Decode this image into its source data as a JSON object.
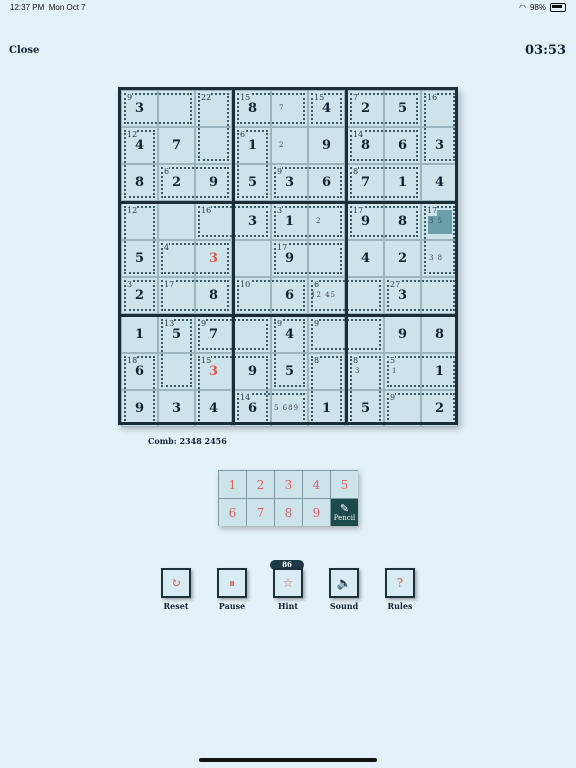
{
  "status": {
    "time": "12:37 PM",
    "date": "Mon Oct 7",
    "battery": "98%"
  },
  "header": {
    "close_label": "Close",
    "timer": "03:53"
  },
  "grid": {
    "values": [
      [
        "3",
        "",
        "",
        "8",
        "",
        "4",
        "2",
        "5",
        ""
      ],
      [
        "4",
        "7",
        "",
        "1",
        "",
        "9",
        "8",
        "6",
        "3"
      ],
      [
        "8",
        "2",
        "9",
        "5",
        "3",
        "6",
        "7",
        "1",
        "4"
      ],
      [
        "",
        "",
        "",
        "3",
        "1",
        "",
        "9",
        "8",
        ""
      ],
      [
        "5",
        "",
        "3",
        "",
        "9",
        "",
        "4",
        "2",
        ""
      ],
      [
        "2",
        "",
        "8",
        "",
        "6",
        "",
        "",
        "3",
        ""
      ],
      [
        "1",
        "5",
        "7",
        "",
        "4",
        "",
        "",
        "9",
        "8"
      ],
      [
        "6",
        "",
        "3",
        "9",
        "5",
        "",
        "",
        "",
        "1"
      ],
      [
        "9",
        "3",
        "4",
        "6",
        "",
        "1",
        "5",
        "",
        "2"
      ]
    ],
    "user_cells": [
      [
        4,
        2
      ],
      [
        7,
        2
      ]
    ],
    "selected": [
      3,
      8
    ],
    "pencil": [
      {
        "r": 0,
        "c": 4,
        "text": "7"
      },
      {
        "r": 1,
        "c": 4,
        "text": "2"
      },
      {
        "r": 3,
        "c": 5,
        "text": "2"
      },
      {
        "r": 3,
        "c": 8,
        "text": "3 5"
      },
      {
        "r": 4,
        "c": 8,
        "text": "3 8"
      },
      {
        "r": 5,
        "c": 5,
        "text": "12 45"
      },
      {
        "r": 7,
        "c": 6,
        "text": "3"
      },
      {
        "r": 7,
        "c": 7,
        "text": "1"
      },
      {
        "r": 8,
        "c": 4,
        "text": "5 689"
      }
    ],
    "cages": [
      {
        "sum": "9",
        "cells": [
          [
            0,
            0
          ],
          [
            0,
            1
          ]
        ]
      },
      {
        "sum": "22",
        "cells": [
          [
            0,
            2
          ],
          [
            1,
            2
          ]
        ]
      },
      {
        "sum": "15",
        "cells": [
          [
            0,
            3
          ],
          [
            0,
            4
          ]
        ]
      },
      {
        "sum": "15",
        "cells": [
          [
            0,
            5
          ]
        ]
      },
      {
        "sum": "7",
        "cells": [
          [
            0,
            6
          ],
          [
            0,
            7
          ]
        ]
      },
      {
        "sum": "16",
        "cells": [
          [
            0,
            8
          ],
          [
            1,
            8
          ]
        ]
      },
      {
        "sum": "12",
        "cells": [
          [
            1,
            0
          ],
          [
            2,
            0
          ]
        ]
      },
      {
        "sum": "6",
        "cells": [
          [
            1,
            3
          ],
          [
            2,
            3
          ]
        ]
      },
      {
        "sum": "14",
        "cells": [
          [
            1,
            6
          ],
          [
            1,
            7
          ]
        ]
      },
      {
        "sum": "6",
        "cells": [
          [
            2,
            1
          ],
          [
            2,
            2
          ]
        ]
      },
      {
        "sum": "9",
        "cells": [
          [
            2,
            4
          ],
          [
            2,
            5
          ]
        ]
      },
      {
        "sum": "8",
        "cells": [
          [
            2,
            6
          ],
          [
            2,
            7
          ]
        ]
      },
      {
        "sum": "12",
        "cells": [
          [
            3,
            0
          ],
          [
            4,
            0
          ]
        ]
      },
      {
        "sum": "16",
        "cells": [
          [
            3,
            2
          ],
          [
            3,
            3
          ]
        ]
      },
      {
        "sum": "3",
        "cells": [
          [
            3,
            4
          ],
          [
            3,
            5
          ]
        ]
      },
      {
        "sum": "17",
        "cells": [
          [
            3,
            6
          ],
          [
            3,
            7
          ]
        ]
      },
      {
        "sum": "17",
        "cells": [
          [
            3,
            8
          ],
          [
            4,
            8
          ]
        ]
      },
      {
        "sum": "4",
        "cells": [
          [
            4,
            1
          ],
          [
            4,
            2
          ]
        ]
      },
      {
        "sum": "17",
        "cells": [
          [
            4,
            4
          ],
          [
            4,
            5
          ]
        ]
      },
      {
        "sum": "3",
        "cells": [
          [
            5,
            0
          ]
        ]
      },
      {
        "sum": "17",
        "cells": [
          [
            5,
            1
          ],
          [
            5,
            2
          ]
        ]
      },
      {
        "sum": "10",
        "cells": [
          [
            5,
            3
          ],
          [
            5,
            4
          ]
        ]
      },
      {
        "sum": "6",
        "cells": [
          [
            5,
            5
          ],
          [
            5,
            6
          ]
        ]
      },
      {
        "sum": "27",
        "cells": [
          [
            5,
            7
          ],
          [
            5,
            8
          ]
        ]
      },
      {
        "sum": "13",
        "cells": [
          [
            6,
            1
          ],
          [
            7,
            1
          ]
        ]
      },
      {
        "sum": "9",
        "cells": [
          [
            6,
            2
          ],
          [
            6,
            3
          ]
        ]
      },
      {
        "sum": "9",
        "cells": [
          [
            6,
            4
          ],
          [
            7,
            4
          ]
        ]
      },
      {
        "sum": "9",
        "cells": [
          [
            6,
            5
          ],
          [
            6,
            6
          ]
        ]
      },
      {
        "sum": "18",
        "cells": [
          [
            7,
            0
          ],
          [
            8,
            0
          ]
        ]
      },
      {
        "sum": "15",
        "cells": [
          [
            7,
            2
          ],
          [
            7,
            3
          ],
          [
            8,
            2
          ]
        ]
      },
      {
        "sum": "8",
        "cells": [
          [
            7,
            5
          ],
          [
            8,
            5
          ]
        ]
      },
      {
        "sum": "8",
        "cells": [
          [
            7,
            6
          ],
          [
            8,
            6
          ]
        ]
      },
      {
        "sum": "5",
        "cells": [
          [
            7,
            7
          ],
          [
            7,
            8
          ]
        ]
      },
      {
        "sum": "14",
        "cells": [
          [
            8,
            3
          ],
          [
            8,
            4
          ]
        ]
      },
      {
        "sum": "9",
        "cells": [
          [
            8,
            7
          ],
          [
            8,
            8
          ]
        ]
      }
    ]
  },
  "combination": "Comb: 2348 2456",
  "keypad": {
    "digits": [
      "1",
      "2",
      "3",
      "4",
      "5",
      "6",
      "7",
      "8",
      "9"
    ],
    "pencil_label": "Pencil"
  },
  "toolbar": {
    "hint_count": "86",
    "buttons": [
      {
        "name": "reset",
        "label": "Reset",
        "icon": "reset-icon"
      },
      {
        "name": "pause",
        "label": "Pause",
        "icon": "pause-icon"
      },
      {
        "name": "hint",
        "label": "Hint",
        "icon": "star-icon"
      },
      {
        "name": "sound",
        "label": "Sound",
        "icon": "speaker-icon"
      },
      {
        "name": "rules",
        "label": "Rules",
        "icon": "question-icon"
      }
    ]
  },
  "colors": {
    "accent": "#e45b3a",
    "dark": "#1a2e36",
    "selected": "#6ba0ab"
  }
}
